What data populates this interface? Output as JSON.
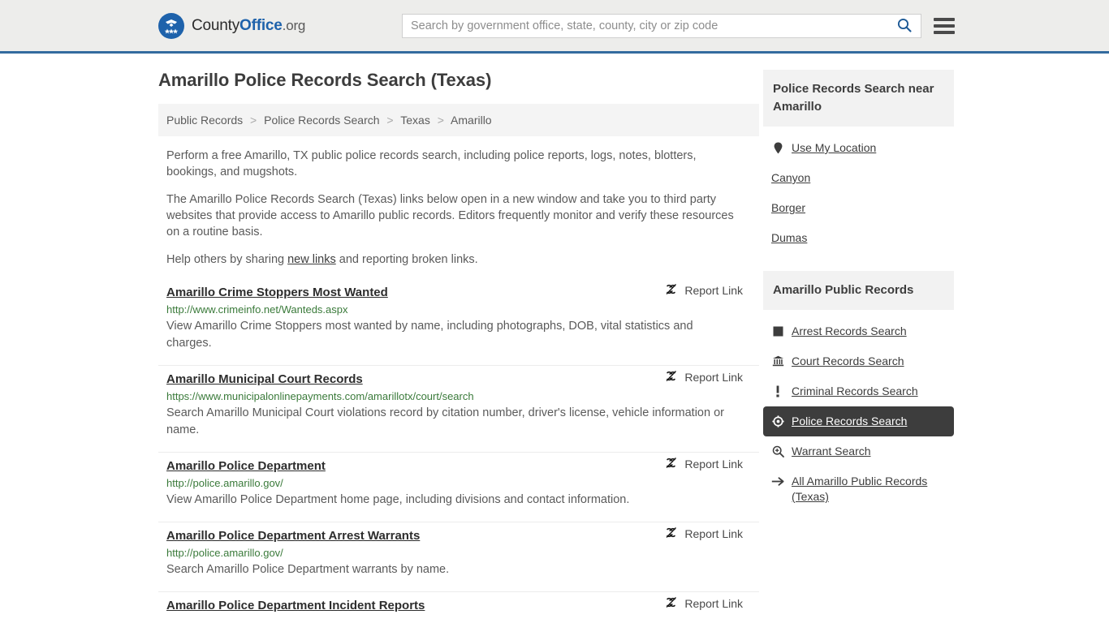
{
  "header": {
    "logo": {
      "icon": "eagle-shield-logo",
      "text_county": "County",
      "text_office": "Office",
      "text_org": ".org"
    },
    "search": {
      "placeholder": "Search by government office, state, county, city or zip code",
      "value": "",
      "icon": "search-icon"
    },
    "menu_icon": "hamburger-menu-icon",
    "accent_color": "#336b9e",
    "background_color": "#ededeb"
  },
  "page_title": "Amarillo Police Records Search (Texas)",
  "breadcrumb": {
    "separator": ">",
    "items": [
      {
        "label": "Public Records"
      },
      {
        "label": "Police Records Search"
      },
      {
        "label": "Texas"
      },
      {
        "label": "Amarillo"
      }
    ]
  },
  "intro": {
    "paragraph_1": "Perform a free Amarillo, TX public police records search, including police reports, logs, notes, blotters, bookings, and mugshots.",
    "paragraph_2": "The Amarillo Police Records Search (Texas) links below open in a new window and take you to third party websites that provide access to Amarillo public records. Editors frequently monitor and verify these resources on a routine basis.",
    "paragraph_3_before": "Help others by sharing ",
    "paragraph_3_link": "new links",
    "paragraph_3_after": " and reporting broken links."
  },
  "report_link": {
    "label": "Report Link",
    "icon": "broken-link-icon"
  },
  "results": [
    {
      "title": "Amarillo Crime Stoppers Most Wanted",
      "url": "http://www.crimeinfo.net/Wanteds.aspx",
      "description": "View Amarillo Crime Stoppers most wanted by name, including photographs, DOB, vital statistics and charges."
    },
    {
      "title": "Amarillo Municipal Court Records",
      "url": "https://www.municipalonlinepayments.com/amarillotx/court/search",
      "description": "Search Amarillo Municipal Court violations record by citation number, driver's license, vehicle information or name."
    },
    {
      "title": "Amarillo Police Department",
      "url": "http://police.amarillo.gov/",
      "description": "View Amarillo Police Department home page, including divisions and contact information."
    },
    {
      "title": "Amarillo Police Department Arrest Warrants",
      "url": "http://police.amarillo.gov/",
      "description": "Search Amarillo Police Department warrants by name."
    },
    {
      "title": "Amarillo Police Department Incident Reports",
      "url": "",
      "description": ""
    }
  ],
  "sidebar": {
    "nearby_panel": {
      "heading": "Police Records Search near Amarillo",
      "items": [
        {
          "label": "Use My Location",
          "icon": "map-pin-icon",
          "has_icon": true
        },
        {
          "label": "Canyon",
          "icon": "",
          "has_icon": false
        },
        {
          "label": "Borger",
          "icon": "",
          "has_icon": false
        },
        {
          "label": "Dumas",
          "icon": "",
          "has_icon": false
        }
      ]
    },
    "records_panel": {
      "heading": "Amarillo Public Records",
      "active_color": "#3d3d3d",
      "items": [
        {
          "label": "Arrest Records Search",
          "icon": "fingerprint-card-icon",
          "active": false
        },
        {
          "label": "Court Records Search",
          "icon": "courthouse-bank-icon",
          "active": false
        },
        {
          "label": "Criminal Records Search",
          "icon": "exclamation-mark-icon",
          "active": false
        },
        {
          "label": "Police Records Search",
          "icon": "police-badge-target-icon",
          "active": true
        },
        {
          "label": "Warrant Search",
          "icon": "magnifier-plus-icon",
          "active": false
        },
        {
          "label": "All Amarillo Public Records (Texas)",
          "icon": "arrow-right-icon",
          "active": false
        }
      ]
    }
  }
}
